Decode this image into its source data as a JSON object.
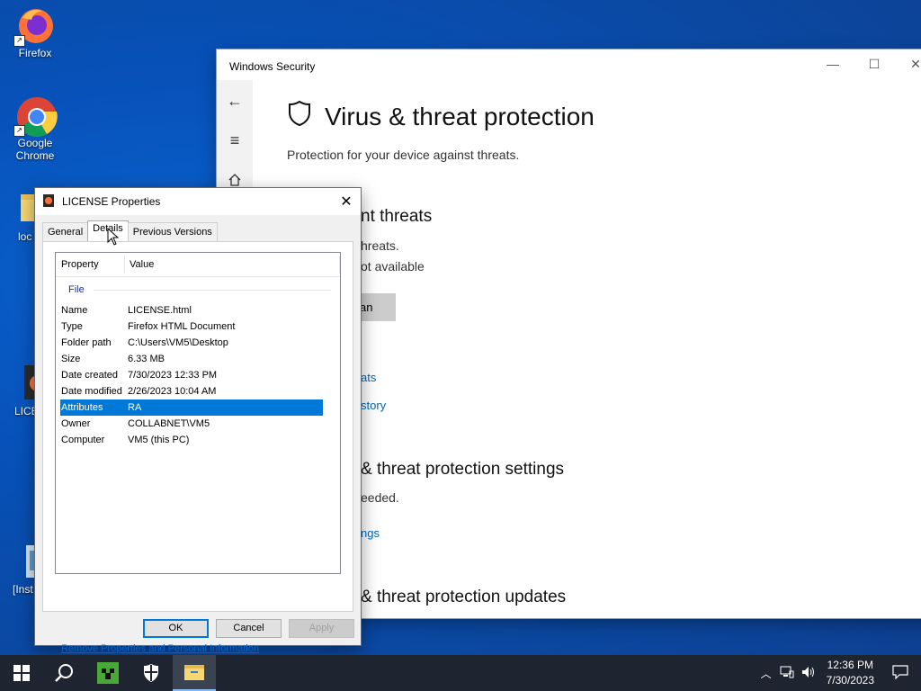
{
  "desktop": {
    "icons": [
      {
        "label": "Firefox"
      },
      {
        "label": "Google Chrome"
      },
      {
        "label": "loc"
      },
      {
        "label": "LICE"
      },
      {
        "label": "[Inst"
      }
    ]
  },
  "winsec": {
    "title": "Windows Security",
    "heading": "Virus & threat protection",
    "subheading": "Protection for your device against threats.",
    "current_threats_heading": "nt threats",
    "threats_line1": "hreats.",
    "threats_line2": "ot available",
    "scan_button": "an",
    "link_threats": "ats",
    "link_history": "story",
    "settings_heading": "& threat protection settings",
    "settings_line": "eeded.",
    "settings_link": "ngs",
    "updates_heading": "& threat protection updates"
  },
  "props": {
    "title": "LICENSE Properties",
    "tabs": [
      "General",
      "Details",
      "Previous Versions"
    ],
    "columns": {
      "property": "Property",
      "value": "Value"
    },
    "group": "File",
    "rows": [
      {
        "k": "Name",
        "v": "LICENSE.html"
      },
      {
        "k": "Type",
        "v": "Firefox HTML Document"
      },
      {
        "k": "Folder path",
        "v": "C:\\Users\\VM5\\Desktop"
      },
      {
        "k": "Size",
        "v": "6.33 MB"
      },
      {
        "k": "Date created",
        "v": "7/30/2023 12:33 PM"
      },
      {
        "k": "Date modified",
        "v": "2/26/2023 10:04 AM"
      },
      {
        "k": "Attributes",
        "v": "RA"
      },
      {
        "k": "Owner",
        "v": "COLLABNET\\VM5"
      },
      {
        "k": "Computer",
        "v": "VM5 (this PC)"
      }
    ],
    "remove_link": "Remove Properties and Personal Information",
    "ok": "OK",
    "cancel": "Cancel",
    "apply": "Apply"
  },
  "taskbar": {
    "time": "12:36 PM",
    "date": "7/30/2023"
  }
}
